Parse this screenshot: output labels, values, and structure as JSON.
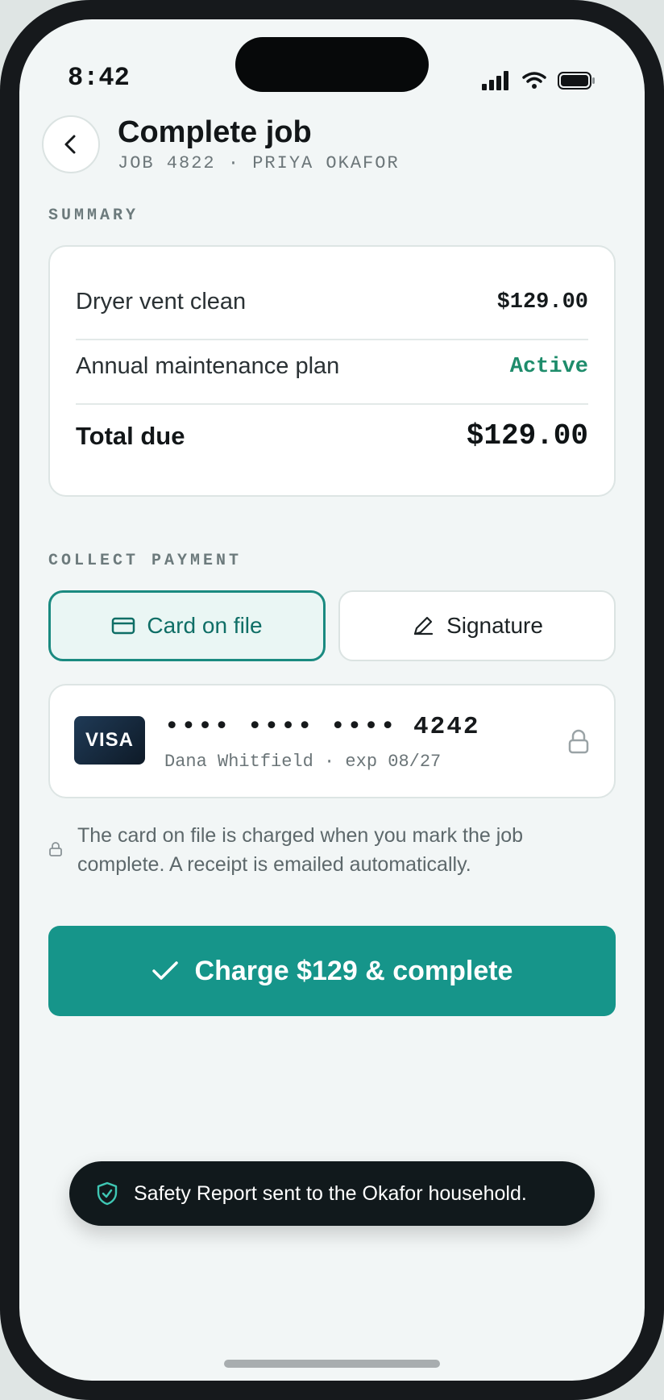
{
  "status_bar": {
    "time": "8:42"
  },
  "header": {
    "title": "Complete job",
    "subtitle": "JOB 4822 · PRIYA OKAFOR"
  },
  "summary": {
    "section_label": "SUMMARY",
    "rows": [
      {
        "label": "Dryer vent clean",
        "value": "$129.00"
      },
      {
        "label": "Annual maintenance plan",
        "value": "Active"
      }
    ],
    "total_label": "Total due",
    "total_value": "$129.00"
  },
  "payment": {
    "section_label": "COLLECT PAYMENT",
    "options": [
      {
        "label": "Card on file",
        "selected": true
      },
      {
        "label": "Signature",
        "selected": false
      }
    ],
    "card": {
      "brand": "VISA",
      "number": "•••• •••• •••• 4242",
      "meta": "Dana Whitfield · exp 08/27"
    },
    "notice": "The card on file is charged when you mark the job complete. A receipt is emailed automatically."
  },
  "charge_button": {
    "label": "Charge $129 & complete"
  },
  "toast": {
    "message": "Safety Report sent to the Okafor household."
  },
  "colors": {
    "accent": "#16958a",
    "active_status": "#1e8c6b",
    "toast_bg": "#11191c"
  },
  "icons": [
    "back-chevron-icon",
    "signal-icon",
    "wifi-icon",
    "battery-icon",
    "card-icon",
    "pen-icon",
    "lock-icon",
    "check-icon",
    "shield-check-icon"
  ]
}
